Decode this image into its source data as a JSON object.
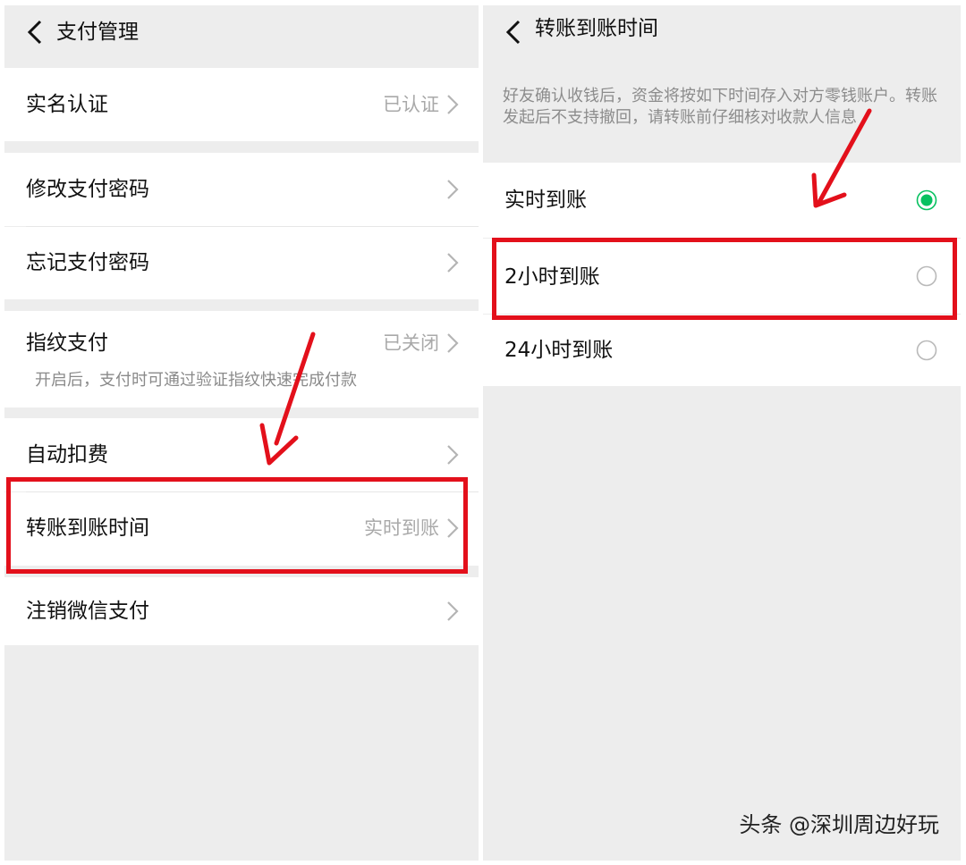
{
  "left": {
    "title": "支付管理",
    "rows": [
      {
        "label": "实名认证",
        "value": "已认证"
      },
      {
        "label": "修改支付密码",
        "value": ""
      },
      {
        "label": "忘记支付密码",
        "value": ""
      },
      {
        "label": "指纹支付",
        "value": "已关闭",
        "sub": "开启后，支付时可通过验证指纹快速完成付款"
      },
      {
        "label": "自动扣费",
        "value": ""
      },
      {
        "label": "转账到账时间",
        "value": "实时到账"
      },
      {
        "label": "注销微信支付",
        "value": ""
      }
    ]
  },
  "right": {
    "title": "转账到账时间",
    "description": "好友确认收钱后，资金将按如下时间存入对方零钱账户。转账发起后不支持撤回，请转账前仔细核对收款人信息",
    "options": [
      {
        "label": "实时到账",
        "selected": true
      },
      {
        "label": "2小时到账",
        "selected": false
      },
      {
        "label": "24小时到账",
        "selected": false
      }
    ]
  },
  "watermark": "头条 @深圳周边好玩",
  "colors": {
    "accent": "#07c160",
    "annotation": "#e3101b",
    "background": "#ededed",
    "muted_text": "#a9a9a9"
  },
  "icons": {
    "back": "chevron-left-icon",
    "row_arrow": "chevron-right-icon",
    "selected": "radio-checked-icon",
    "unselected": "radio-empty-icon"
  }
}
